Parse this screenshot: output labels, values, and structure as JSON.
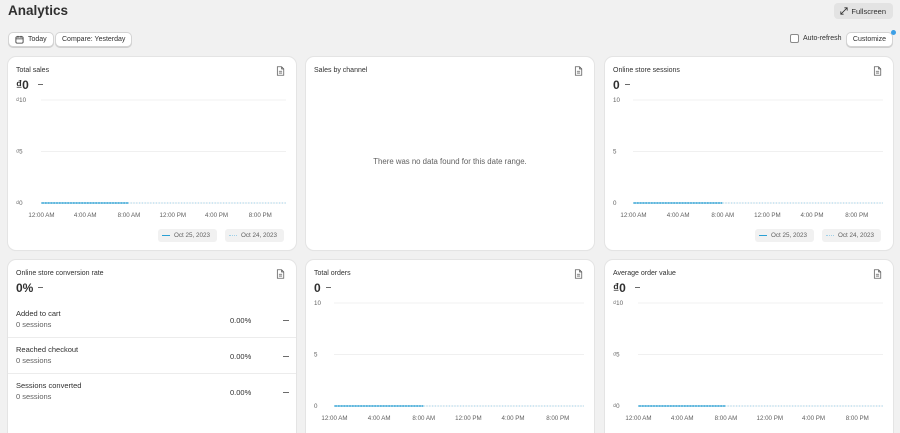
{
  "header": {
    "title": "Analytics",
    "fullscreen_label": "Fullscreen"
  },
  "toolbar": {
    "date_label": "Today",
    "compare_label": "Compare: Yesterday",
    "autorefresh_label": "Auto-refresh",
    "autorefresh_checked": false,
    "customize_label": "Customize"
  },
  "colors": {
    "primary_series": "#2aa0d4",
    "comparison_series": "#9fd0e8",
    "background": "#f1f1f1"
  },
  "cards": {
    "total_sales": {
      "title": "Total sales",
      "value": "₫0",
      "change": "—",
      "legend_current": "Oct 25, 2023",
      "legend_previous": "Oct 24, 2023"
    },
    "sales_by_channel": {
      "title": "Sales by channel",
      "empty_message": "There was no data found for this date range."
    },
    "online_store_sessions": {
      "title": "Online store sessions",
      "value": "0",
      "change": "—",
      "legend_current": "Oct 25, 2023",
      "legend_previous": "Oct 24, 2023"
    },
    "conversion_rate": {
      "title": "Online store conversion rate",
      "value": "0%",
      "change": "—",
      "rows": [
        {
          "label": "Added to cart",
          "sub": "0 sessions",
          "value": "0.00%",
          "change": "—"
        },
        {
          "label": "Reached checkout",
          "sub": "0 sessions",
          "value": "0.00%",
          "change": "—"
        },
        {
          "label": "Sessions converted",
          "sub": "0 sessions",
          "value": "0.00%",
          "change": "—"
        }
      ]
    },
    "total_orders": {
      "title": "Total orders",
      "value": "0",
      "change": "—"
    },
    "average_order_value": {
      "title": "Average order value",
      "value": "₫0",
      "change": "—"
    }
  },
  "chart_data": [
    {
      "id": "total_sales",
      "type": "line",
      "title": "Total sales",
      "x": [
        "12:00 AM",
        "4:00 AM",
        "8:00 AM",
        "12:00 PM",
        "4:00 PM",
        "8:00 PM"
      ],
      "y_ticks": [
        "₫0",
        "₫5",
        "₫10"
      ],
      "ylim": [
        0,
        10
      ],
      "grid": true,
      "legend_position": "bottom-right",
      "series": [
        {
          "name": "Oct 25, 2023",
          "style": "solid",
          "values": [
            0,
            0,
            0
          ]
        },
        {
          "name": "Oct 24, 2023",
          "style": "dotted",
          "values": [
            0,
            0,
            0,
            0,
            0,
            0
          ]
        }
      ]
    },
    {
      "id": "online_store_sessions",
      "type": "line",
      "title": "Online store sessions",
      "x": [
        "12:00 AM",
        "4:00 AM",
        "8:00 AM",
        "12:00 PM",
        "4:00 PM",
        "8:00 PM"
      ],
      "y_ticks": [
        "0",
        "5",
        "10"
      ],
      "ylim": [
        0,
        10
      ],
      "grid": true,
      "legend_position": "bottom-right",
      "series": [
        {
          "name": "Oct 25, 2023",
          "style": "solid",
          "values": [
            0,
            0,
            0
          ]
        },
        {
          "name": "Oct 24, 2023",
          "style": "dotted",
          "values": [
            0,
            0,
            0,
            0,
            0,
            0
          ]
        }
      ]
    },
    {
      "id": "total_orders",
      "type": "line",
      "title": "Total orders",
      "x": [
        "12:00 AM",
        "4:00 AM",
        "8:00 AM",
        "12:00 PM",
        "4:00 PM",
        "8:00 PM"
      ],
      "y_ticks": [
        "0",
        "5",
        "10"
      ],
      "ylim": [
        0,
        10
      ],
      "grid": true,
      "series": [
        {
          "style": "solid",
          "values": [
            0,
            0,
            0
          ]
        },
        {
          "style": "dotted",
          "values": [
            0,
            0,
            0,
            0,
            0,
            0
          ]
        }
      ]
    },
    {
      "id": "average_order_value",
      "type": "line",
      "title": "Average order value",
      "x": [
        "12:00 AM",
        "4:00 AM",
        "8:00 AM",
        "12:00 PM",
        "4:00 PM",
        "8:00 PM"
      ],
      "y_ticks": [
        "₫0",
        "₫5",
        "₫10"
      ],
      "ylim": [
        0,
        10
      ],
      "grid": true,
      "series": [
        {
          "style": "solid",
          "values": [
            0,
            0,
            0
          ]
        },
        {
          "style": "dotted",
          "values": [
            0,
            0,
            0,
            0,
            0,
            0
          ]
        }
      ]
    }
  ]
}
